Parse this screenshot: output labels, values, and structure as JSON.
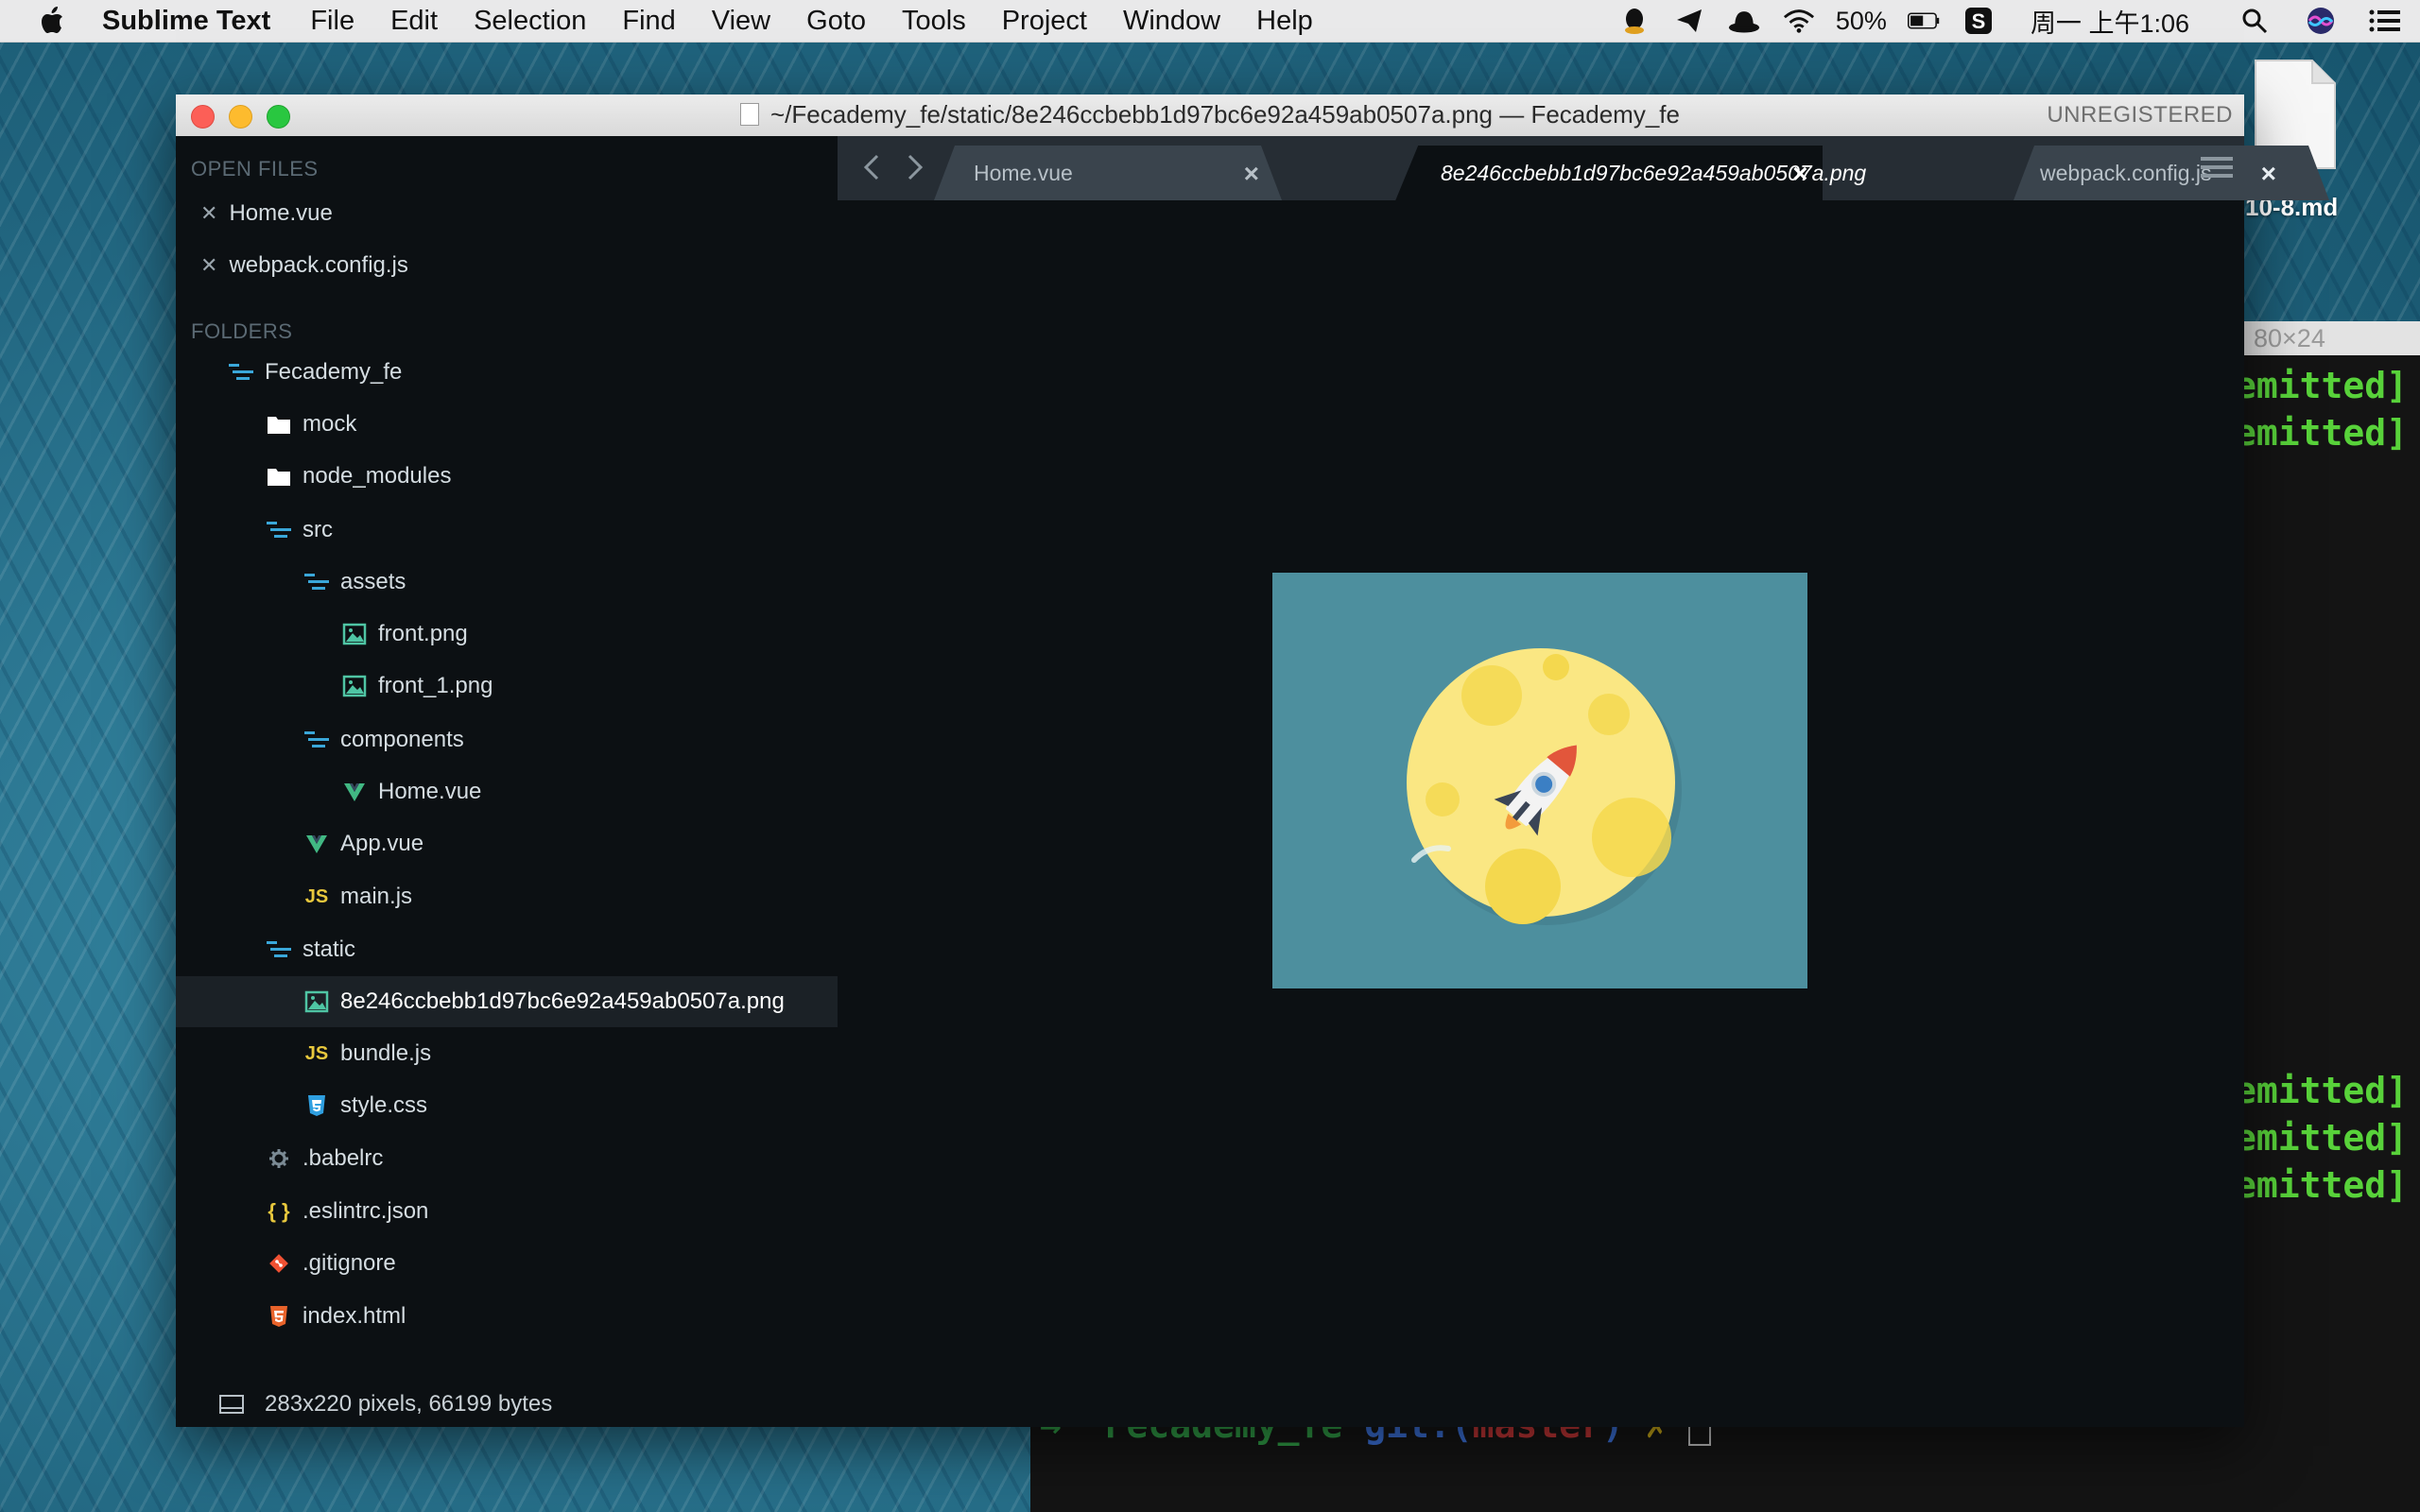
{
  "menubar": {
    "app_name": "Sublime Text",
    "items": [
      "File",
      "Edit",
      "Selection",
      "Find",
      "View",
      "Goto",
      "Tools",
      "Project",
      "Window",
      "Help"
    ],
    "battery": "50%",
    "clock": "周一 上午1:06"
  },
  "desktop": {
    "file_label": "10-8.md"
  },
  "terminal": {
    "size_label": "80×24",
    "lines": [
      "emitted]",
      "emitted]",
      "emitted]",
      "emitted]",
      "emitted]"
    ],
    "prompt": "Fecademy_fe",
    "git_label": "git:(",
    "branch": "master",
    "git_close": ")",
    "dirty": "✗"
  },
  "window": {
    "title": "~/Fecademy_fe/static/8e246ccbebb1d97bc6e92a459ab0507a.png — Fecademy_fe",
    "unregistered": "UNREGISTERED"
  },
  "sidebar": {
    "open_files_header": "OPEN FILES",
    "open_files": [
      "Home.vue",
      "webpack.config.js"
    ],
    "folders_header": "FOLDERS",
    "tree": [
      {
        "label": "Fecademy_fe",
        "icon": "folder-open-icon"
      },
      {
        "label": "mock",
        "icon": "folder-icon"
      },
      {
        "label": "node_modules",
        "icon": "folder-icon"
      },
      {
        "label": "src",
        "icon": "folder-open-icon"
      },
      {
        "label": "assets",
        "icon": "folder-open-icon"
      },
      {
        "label": "front.png",
        "icon": "image-file-icon"
      },
      {
        "label": "front_1.png",
        "icon": "image-file-icon"
      },
      {
        "label": "components",
        "icon": "folder-open-icon"
      },
      {
        "label": "Home.vue",
        "icon": "vue-file-icon"
      },
      {
        "label": "App.vue",
        "icon": "vue-file-icon"
      },
      {
        "label": "main.js",
        "icon": "js-file-icon"
      },
      {
        "label": "static",
        "icon": "folder-open-icon"
      },
      {
        "label": "8e246ccbebb1d97bc6e92a459ab0507a.png",
        "icon": "image-file-icon"
      },
      {
        "label": "bundle.js",
        "icon": "js-file-icon"
      },
      {
        "label": "style.css",
        "icon": "css-file-icon"
      },
      {
        "label": ".babelrc",
        "icon": "gear-icon"
      },
      {
        "label": ".eslintrc.json",
        "icon": "json-file-icon"
      },
      {
        "label": ".gitignore",
        "icon": "git-icon"
      },
      {
        "label": "index.html",
        "icon": "html-file-icon"
      }
    ],
    "js_badge": "JS",
    "json_badge": "{ }",
    "status": "283x220 pixels, 66199 bytes"
  },
  "tabs": [
    {
      "label": "Home.vue",
      "active": false
    },
    {
      "label": "8e246ccbebb1d97bc6e92a459ab0507a.png",
      "active": true
    },
    {
      "label": "webpack.config.js",
      "active": false
    }
  ],
  "colors": {
    "editor_bg": "#0c1013",
    "tab_active": "#0c1013",
    "tab_inactive": "#3a444d",
    "image_bg": "#4d8f9e",
    "moon": "#fae783",
    "folder_accent": "#3aa7d9",
    "vue_green": "#41b883",
    "js_yellow": "#e8c83d"
  }
}
